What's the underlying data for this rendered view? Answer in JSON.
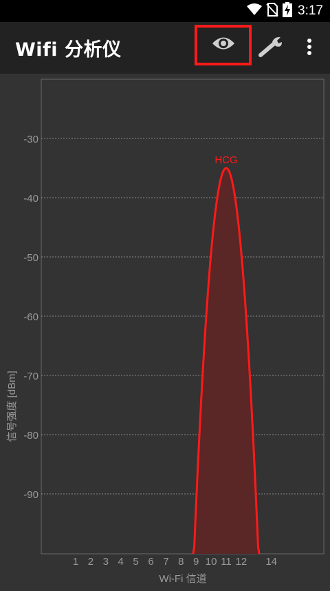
{
  "status_bar": {
    "time": "3:17",
    "icons": [
      "wifi-icon",
      "no-sim-icon",
      "battery-charging-icon"
    ]
  },
  "app_bar": {
    "title": "Wifi 分析仪",
    "actions": [
      "eye-icon",
      "wrench-icon",
      "more-vert-icon"
    ],
    "highlight_color": "#ff1a1a"
  },
  "chart_data": {
    "type": "area",
    "ylabel": "信号强度 [dBm]",
    "xlabel": "Wi-Fi 信道",
    "y_ticks": [
      "-30",
      "-40",
      "-50",
      "-60",
      "-70",
      "-80",
      "-90"
    ],
    "y_tick_values": [
      -30,
      -40,
      -50,
      -60,
      -70,
      -80,
      -90
    ],
    "ylim": [
      -100,
      -20
    ],
    "x_ticks": [
      "1",
      "2",
      "3",
      "4",
      "5",
      "6",
      "7",
      "8",
      "9",
      "10",
      "11",
      "12",
      "14"
    ],
    "x_tick_values": [
      1,
      2,
      3,
      4,
      5,
      6,
      7,
      8,
      9,
      10,
      11,
      12,
      14
    ],
    "grid": true,
    "series": [
      {
        "name": "HCG",
        "channel": 11,
        "peak_dbm": -35,
        "span_channels": [
          9,
          13
        ],
        "color": "#ff1a1a",
        "fill": "#5a2626"
      }
    ],
    "colors": {
      "axis_text": "#9a9a9a",
      "grid": "#8a8a8a",
      "frame": "#6a6a6a"
    }
  }
}
